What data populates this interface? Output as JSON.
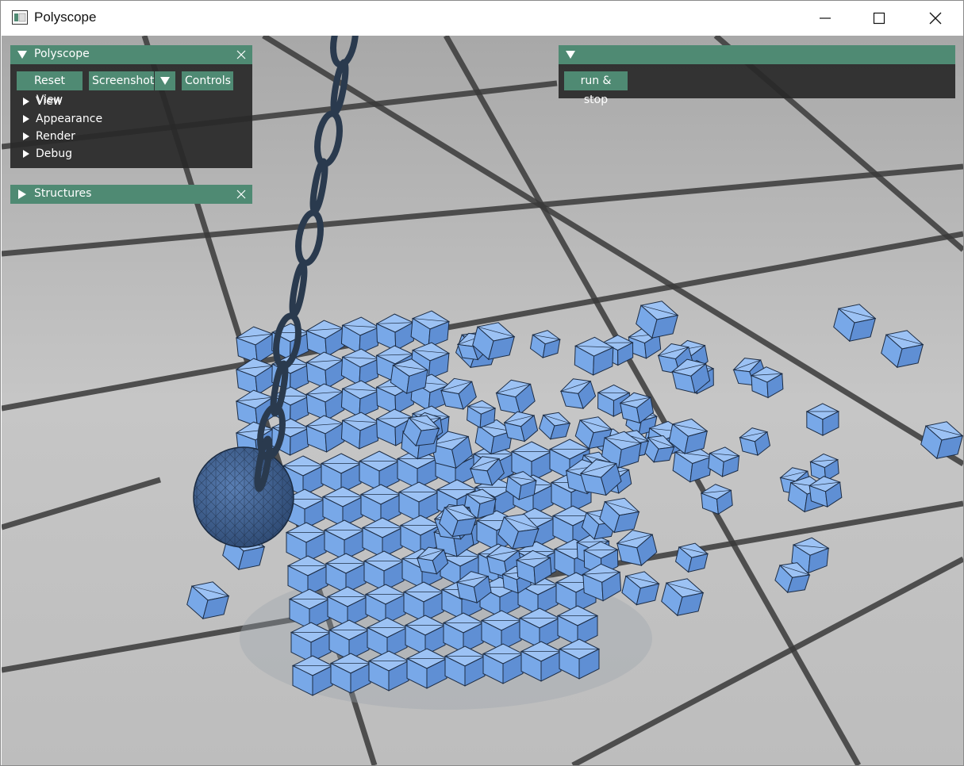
{
  "window": {
    "title": "Polyscope"
  },
  "polyscope_panel": {
    "title": "Polyscope",
    "buttons": {
      "reset_view": "Reset View",
      "screenshot": "Screenshot",
      "controls": "Controls"
    },
    "tree_items": [
      "View",
      "Appearance",
      "Render",
      "Debug"
    ]
  },
  "structures_panel": {
    "title": "Structures"
  },
  "user_panel": {
    "title": "",
    "run_stop_label": "run & stop"
  },
  "colors": {
    "accent": "#4f8a73",
    "panel_bg": "#282828",
    "cube": "#78a8e8",
    "floor": "#b8b8b8",
    "grout": "#3a3a3a",
    "chain": "#2a3a4e"
  }
}
